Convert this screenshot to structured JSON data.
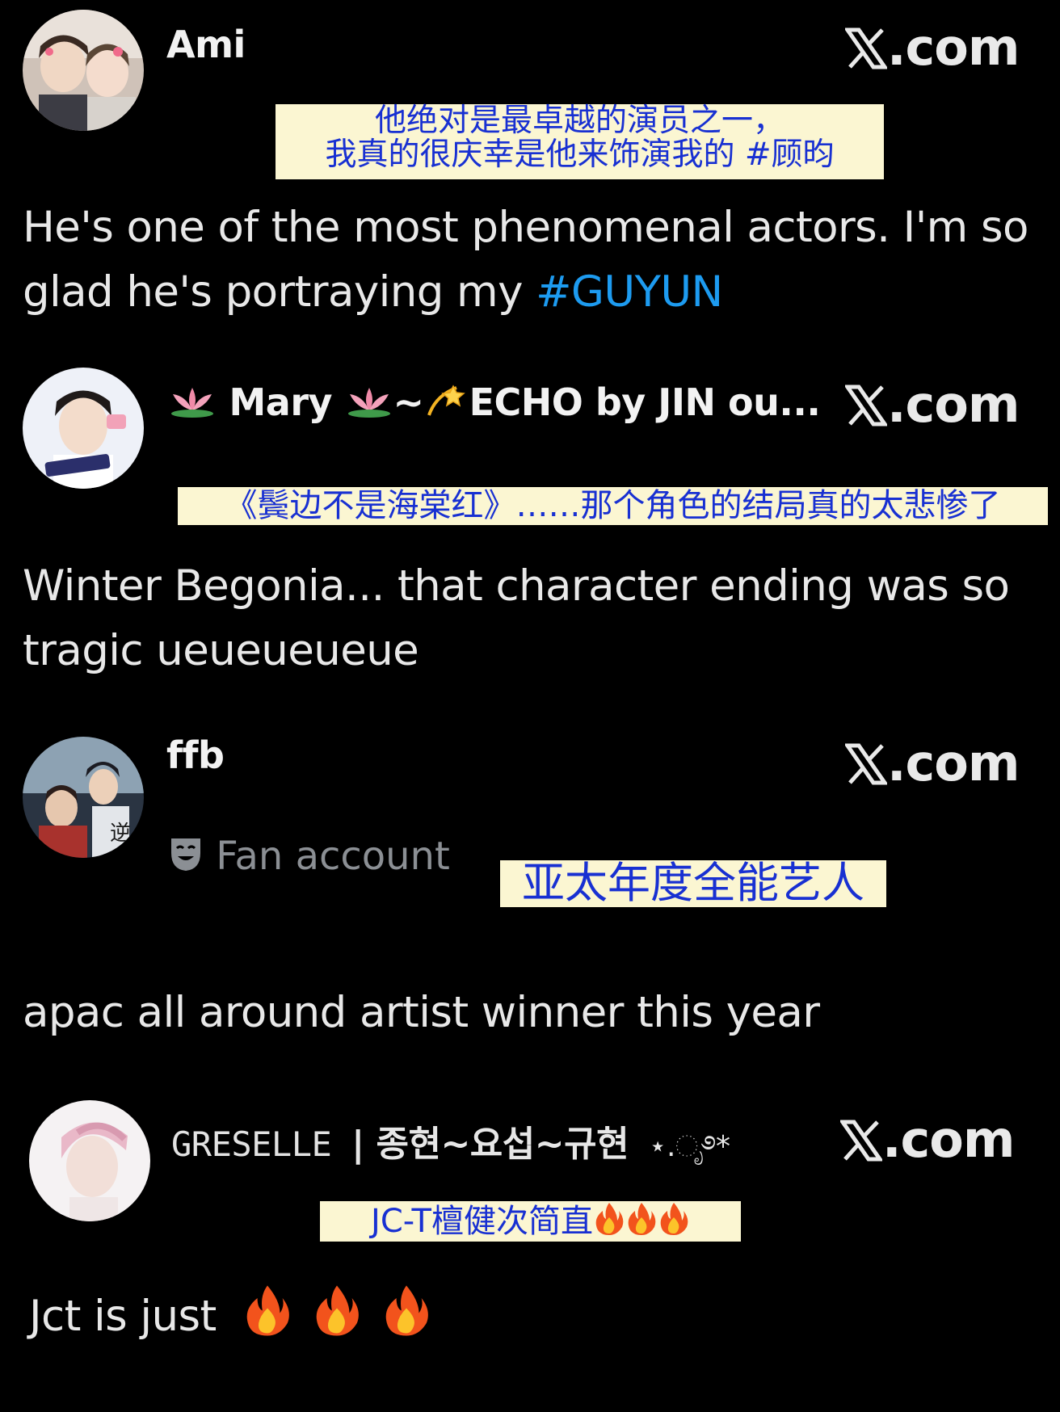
{
  "brand_text": ".com",
  "posts": [
    {
      "name": "Ami",
      "caption_lines": [
        "他绝对是最卓越的演员之一，",
        "我真的很庆幸是他来饰演我的 #顾昀"
      ],
      "text_line1": "He's one of the most phenomenal actors. I'm so",
      "text_line2_prefix": "glad he's portraying my ",
      "hashtag": "#GUYUN"
    },
    {
      "name_part1": "Mary",
      "name_part2": "~",
      "name_part3": "ECHO by JIN ou...",
      "caption": "《鬓边不是海棠红》……那个角色的结局真的太悲惨了",
      "text_line1": "Winter Begonia... that character ending was so",
      "text_line2": "tragic ueueueueue"
    },
    {
      "name": "ffb",
      "badge": "Fan account",
      "caption": "亚太年度全能艺人",
      "text": "apac all around artist winner this year"
    },
    {
      "name_latin": "GRESELLE",
      "name_korean": "| 종현~요섭~규현",
      "name_deco": "⋆.ೃ࿔*",
      "caption_text": "JC-T檀健次简直",
      "text": "Jct is just"
    }
  ],
  "colors": {
    "background": "#000000",
    "text": "#e8e8e8",
    "hashtag": "#1d9bf0",
    "caption_bg": "#fbf6d2",
    "caption_text": "#1830d2",
    "muted": "#8b8f94"
  }
}
